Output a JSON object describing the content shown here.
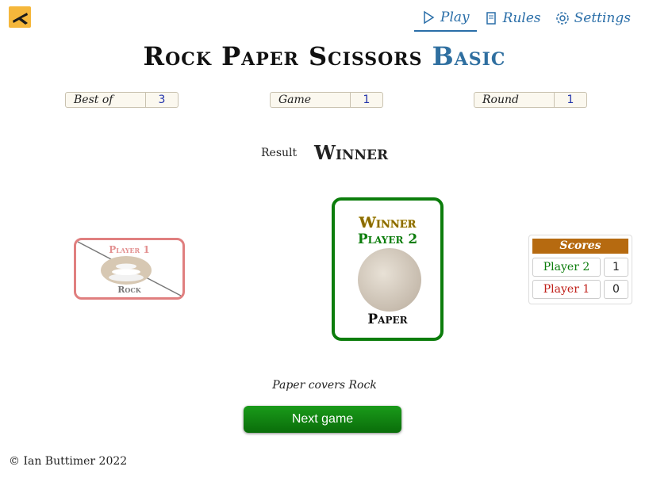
{
  "nav": {
    "play": "Play",
    "rules": "Rules",
    "settings": "Settings"
  },
  "title": {
    "main": "Rock Paper Scissors",
    "accent": "Basic"
  },
  "stats": {
    "best_of_label": "Best of",
    "best_of_value": "3",
    "game_label": "Game",
    "game_value": "1",
    "round_label": "Round",
    "round_value": "1"
  },
  "result": {
    "label": "Result",
    "value": "Winner"
  },
  "player1": {
    "name": "Player 1",
    "move": "Rock"
  },
  "player2": {
    "status": "Winner",
    "name": "Player 2",
    "move": "Paper"
  },
  "scores": {
    "header": "Scores",
    "rows": [
      {
        "name": "Player 2",
        "score": "1"
      },
      {
        "name": "Player 1",
        "score": "0"
      }
    ]
  },
  "explanation": "Paper covers Rock",
  "next_button": "Next game",
  "footer": "© Ian Buttimer 2022",
  "colors": {
    "accent_blue": "#2f6fa0",
    "winner_green": "#0c7d0c",
    "loser_red": "#e07f7f",
    "score_header": "#b66a10"
  }
}
